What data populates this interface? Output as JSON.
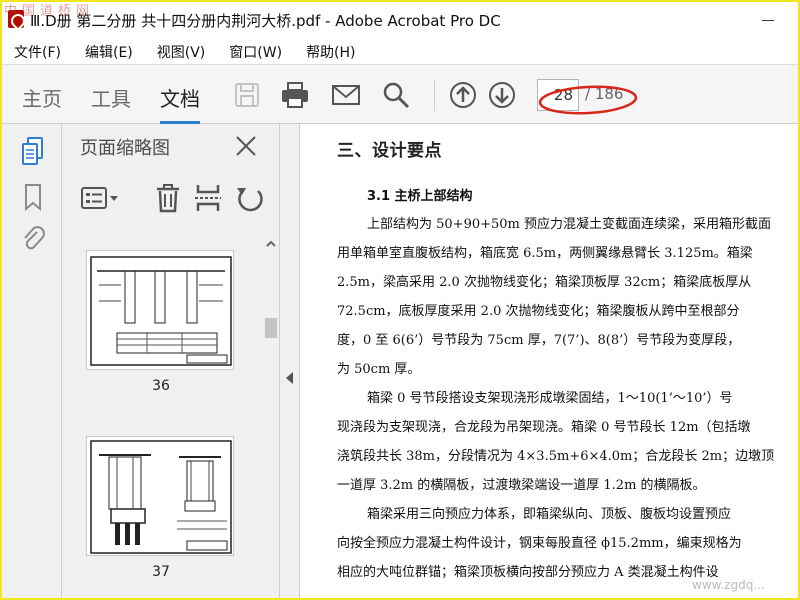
{
  "window": {
    "title": "Ⅲ.D册 第二分册 共十四分册内荆河大桥.pdf - Adobe Acrobat Pro DC",
    "watermark_top": "中国道桥网",
    "watermark_bottom": "www.zgdq..."
  },
  "menu": [
    {
      "label": "文件(F)"
    },
    {
      "label": "编辑(E)"
    },
    {
      "label": "视图(V)"
    },
    {
      "label": "窗口(W)"
    },
    {
      "label": "帮助(H)"
    }
  ],
  "toolbar": {
    "tabs": [
      {
        "label": "主页",
        "active": false
      },
      {
        "label": "工具",
        "active": false
      },
      {
        "label": "文档",
        "active": true
      }
    ],
    "icons": [
      "save-icon",
      "print-icon",
      "email-icon",
      "search-icon",
      "prev-page-icon",
      "next-page-icon"
    ],
    "page_current": "28",
    "page_total": "/ 186",
    "accent_color": "#2d7fd1",
    "annotation_color": "#d9261c"
  },
  "left_rail": {
    "icons": [
      "page-thumbnails-icon",
      "bookmarks-icon",
      "attachments-icon"
    ]
  },
  "thumb_panel": {
    "title": "页面缩略图",
    "tools": [
      "page-options-icon",
      "delete-icon",
      "extract-icon",
      "rotate-icon"
    ],
    "thumbnails": [
      {
        "label": "36"
      },
      {
        "label": "37"
      }
    ]
  },
  "document": {
    "heading": "三、设计要点",
    "subheading": "3.1 主桥上部结构",
    "lines": [
      {
        "text": "上部结构为 50+90+50m 预应力混凝土变截面连续梁，采用箱形截面",
        "indent": true
      },
      {
        "text": "用单箱单室直腹板结构，箱底宽 6.5m，两侧翼缘悬臂长 3.125m。箱梁",
        "indent": false
      },
      {
        "text": "2.5m，梁高采用 2.0 次抛物线变化；箱梁顶板厚 32cm；箱梁底板厚从",
        "indent": false
      },
      {
        "text": "72.5cm，底板厚度采用 2.0 次抛物线变化；箱梁腹板从跨中至根部分",
        "indent": false
      },
      {
        "text": "度，0 至 6(6’）号节段为 75cm 厚，7(7’)、8(8’）号节段为变厚段，",
        "indent": false
      },
      {
        "text": "为 50cm 厚。",
        "indent": false
      },
      {
        "text": "箱梁 0 号节段搭设支架现浇形成墩梁固结，1～10(1’～10’）号",
        "indent": true
      },
      {
        "text": "现浇段为支架现浇，合龙段为吊架现浇。箱梁 0 号节段长 12m（包括墩",
        "indent": false
      },
      {
        "text": "浇筑段共长 38m，分段情况为 4×3.5m+6×4.0m；合龙段长 2m；边墩顶",
        "indent": false
      },
      {
        "text": "一道厚 3.2m 的横隔板，过渡墩梁端设一道厚 1.2m 的横隔板。",
        "indent": false
      },
      {
        "text": "箱梁采用三向预应力体系，即箱梁纵向、顶板、腹板均设置预应",
        "indent": true
      },
      {
        "text": "向按全预应力混凝土构件设计，钢束每股直径 ϕ15.2mm，编束规格为",
        "indent": false
      },
      {
        "text": "相应的大吨位群锚；箱梁顶板横向按部分预应力 A 类混凝土构件设",
        "indent": false
      }
    ]
  }
}
